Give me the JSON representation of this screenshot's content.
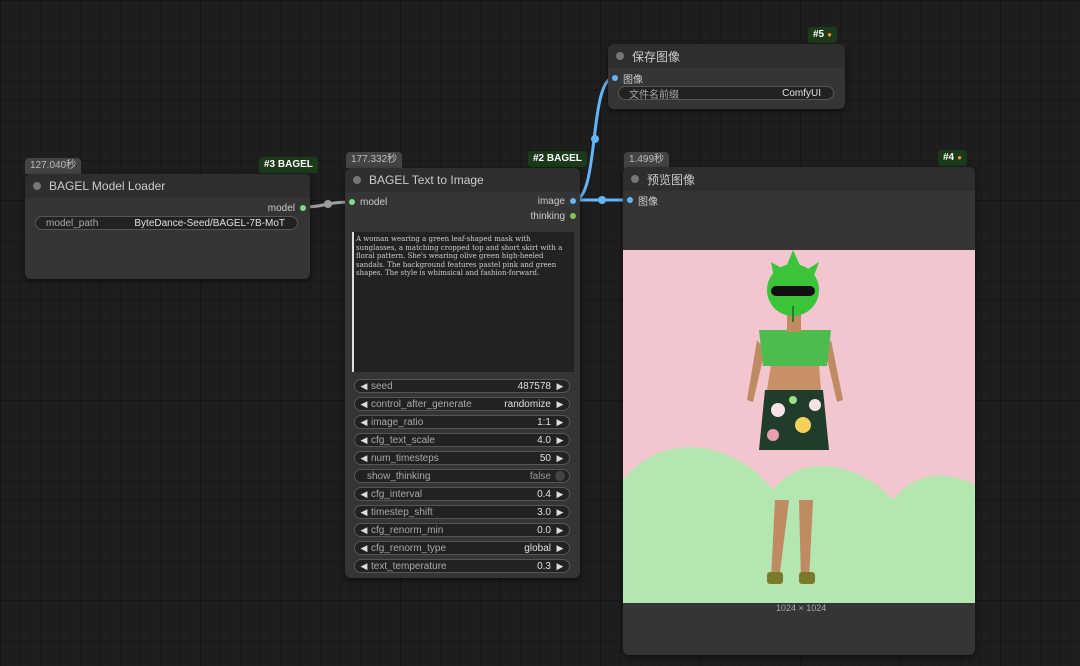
{
  "nodes": {
    "loader": {
      "timer": "127.040秒",
      "badge": "#3 BAGEL",
      "title": "BAGEL Model Loader",
      "output_model": "model",
      "model_path_label": "model_path",
      "model_path_value": "ByteDance-Seed/BAGEL-7B-MoT"
    },
    "t2i": {
      "timer": "177.332秒",
      "badge": "#2 BAGEL",
      "title": "BAGEL Text to Image",
      "input_model": "model",
      "output_image": "image",
      "output_thinking": "thinking",
      "prompt": "A woman wearing a green leaf-shaped mask with sunglasses, a matching cropped top and short skirt with a floral pattern. She's wearing olive green high-heeled sandals. The background features pastel pink and green shapes. The style is whimsical and fashion-forward.",
      "widgets": [
        {
          "label": "seed",
          "value": "487578"
        },
        {
          "label": "control_after_generate",
          "value": "randomize"
        },
        {
          "label": "image_ratio",
          "value": "1:1"
        },
        {
          "label": "cfg_text_scale",
          "value": "4.0"
        },
        {
          "label": "num_timesteps",
          "value": "50"
        },
        {
          "label": "show_thinking",
          "value": "false"
        },
        {
          "label": "cfg_interval",
          "value": "0.4"
        },
        {
          "label": "timestep_shift",
          "value": "3.0"
        },
        {
          "label": "cfg_renorm_min",
          "value": "0.0"
        },
        {
          "label": "cfg_renorm_type",
          "value": "global"
        },
        {
          "label": "text_temperature",
          "value": "0.3"
        }
      ]
    },
    "save": {
      "badge": "#5",
      "title": "保存图像",
      "input_image": "图像",
      "prefix_label": "文件名前缀",
      "prefix_value": "ComfyUI"
    },
    "preview": {
      "timer": "1.499秒",
      "badge": "#4",
      "title": "预览图像",
      "input_image": "图像",
      "size": "1024 × 1024"
    }
  },
  "colors": {
    "model_slot": "#7fdf7f",
    "image_slot": "#64b5f6",
    "thinking_slot": "#8bc34a",
    "wire_model": "#9e9e9e",
    "wire_image": "#64b5f6"
  }
}
